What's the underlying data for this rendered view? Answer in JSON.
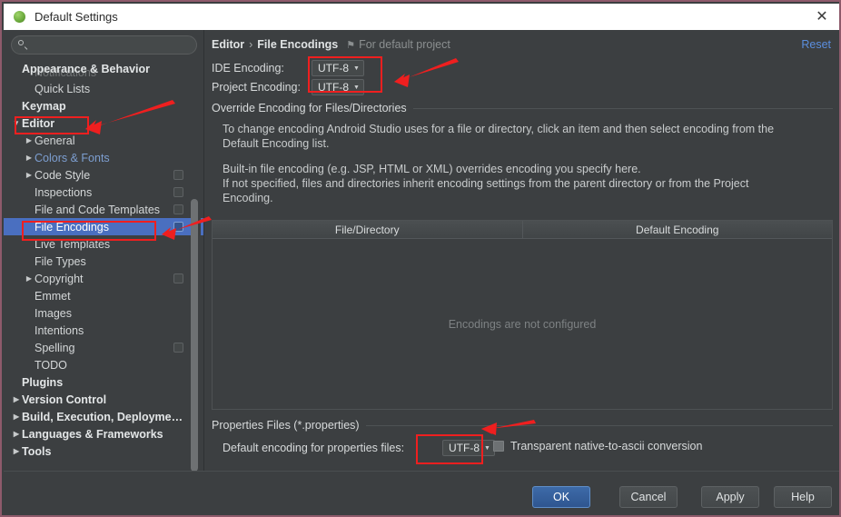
{
  "window": {
    "title": "Default Settings",
    "app_icon": "android-studio-icon",
    "close_icon": "close-icon"
  },
  "search": {
    "placeholder": "",
    "value": "",
    "icon": "search-icon"
  },
  "sidebar": {
    "items": [
      {
        "label": "Appearance & Behavior",
        "indent": 0,
        "bold": true,
        "arrow": "",
        "gutter": false,
        "selected": false,
        "ghost": false,
        "blue": false
      },
      {
        "label": "Notifications",
        "indent": 1,
        "bold": false,
        "arrow": "",
        "gutter": false,
        "selected": false,
        "ghost": true,
        "blue": false
      },
      {
        "label": "Quick Lists",
        "indent": 1,
        "bold": false,
        "arrow": "",
        "gutter": false,
        "selected": false,
        "ghost": false,
        "blue": false
      },
      {
        "label": "Keymap",
        "indent": 0,
        "bold": true,
        "arrow": "",
        "gutter": false,
        "selected": false,
        "ghost": false,
        "blue": false
      },
      {
        "label": "Editor",
        "indent": 0,
        "bold": true,
        "arrow": "▼",
        "gutter": false,
        "selected": false,
        "ghost": false,
        "blue": false
      },
      {
        "label": "General",
        "indent": 1,
        "bold": false,
        "arrow": "▶",
        "gutter": false,
        "selected": false,
        "ghost": false,
        "blue": false
      },
      {
        "label": "Colors & Fonts",
        "indent": 1,
        "bold": false,
        "arrow": "▶",
        "gutter": false,
        "selected": false,
        "ghost": false,
        "blue": true
      },
      {
        "label": "Code Style",
        "indent": 1,
        "bold": false,
        "arrow": "▶",
        "gutter": true,
        "selected": false,
        "ghost": false,
        "blue": false
      },
      {
        "label": "Inspections",
        "indent": 1,
        "bold": false,
        "arrow": "",
        "gutter": true,
        "selected": false,
        "ghost": false,
        "blue": false
      },
      {
        "label": "File and Code Templates",
        "indent": 1,
        "bold": false,
        "arrow": "",
        "gutter": true,
        "selected": false,
        "ghost": false,
        "blue": false
      },
      {
        "label": "File Encodings",
        "indent": 1,
        "bold": false,
        "arrow": "",
        "gutter": true,
        "selected": true,
        "ghost": false,
        "blue": false
      },
      {
        "label": "Live Templates",
        "indent": 1,
        "bold": false,
        "arrow": "",
        "gutter": false,
        "selected": false,
        "ghost": false,
        "blue": false
      },
      {
        "label": "File Types",
        "indent": 1,
        "bold": false,
        "arrow": "",
        "gutter": false,
        "selected": false,
        "ghost": false,
        "blue": false
      },
      {
        "label": "Copyright",
        "indent": 1,
        "bold": false,
        "arrow": "▶",
        "gutter": true,
        "selected": false,
        "ghost": false,
        "blue": false
      },
      {
        "label": "Emmet",
        "indent": 1,
        "bold": false,
        "arrow": "",
        "gutter": false,
        "selected": false,
        "ghost": false,
        "blue": false
      },
      {
        "label": "Images",
        "indent": 1,
        "bold": false,
        "arrow": "",
        "gutter": false,
        "selected": false,
        "ghost": false,
        "blue": false
      },
      {
        "label": "Intentions",
        "indent": 1,
        "bold": false,
        "arrow": "",
        "gutter": false,
        "selected": false,
        "ghost": false,
        "blue": false
      },
      {
        "label": "Spelling",
        "indent": 1,
        "bold": false,
        "arrow": "",
        "gutter": true,
        "selected": false,
        "ghost": false,
        "blue": false
      },
      {
        "label": "TODO",
        "indent": 1,
        "bold": false,
        "arrow": "",
        "gutter": false,
        "selected": false,
        "ghost": false,
        "blue": false
      },
      {
        "label": "Plugins",
        "indent": 0,
        "bold": true,
        "arrow": "",
        "gutter": false,
        "selected": false,
        "ghost": false,
        "blue": false
      },
      {
        "label": "Version Control",
        "indent": 0,
        "bold": true,
        "arrow": "▶",
        "gutter": false,
        "selected": false,
        "ghost": false,
        "blue": false
      },
      {
        "label": "Build, Execution, Deployme…",
        "indent": 0,
        "bold": true,
        "arrow": "▶",
        "gutter": false,
        "selected": false,
        "ghost": false,
        "blue": false
      },
      {
        "label": "Languages & Frameworks",
        "indent": 0,
        "bold": true,
        "arrow": "▶",
        "gutter": false,
        "selected": false,
        "ghost": false,
        "blue": false
      },
      {
        "label": "Tools",
        "indent": 0,
        "bold": true,
        "arrow": "▶",
        "gutter": false,
        "selected": false,
        "ghost": false,
        "blue": false
      }
    ]
  },
  "main": {
    "breadcrumb": {
      "root": "Editor",
      "separator": "›",
      "leaf": "File Encodings",
      "pin_icon": "pin-icon",
      "note": "For default project"
    },
    "reset_label": "Reset",
    "ide_encoding_label": "IDE Encoding:",
    "ide_encoding_value": "UTF-8",
    "project_encoding_label": "Project Encoding:",
    "project_encoding_value": "UTF-8",
    "override_group_title": "Override Encoding for Files/Directories",
    "paragraph_1": "To change encoding Android Studio uses for a file or directory, click an item and then select encoding from the\nDefault Encoding list.",
    "paragraph_2": "Built-in file encoding (e.g. JSP, HTML or XML) overrides encoding you specify here.\nIf not specified, files and directories inherit encoding settings from the parent directory or from the Project\nEncoding.",
    "table": {
      "columns": [
        "File/Directory",
        "Default Encoding"
      ],
      "rows": [],
      "empty_text": "Encodings are not configured"
    },
    "properties_group_title": "Properties Files (*.properties)",
    "properties_encoding_label": "Default encoding for properties files:",
    "properties_encoding_value": "UTF-8",
    "transparent_checkbox_label": "Transparent native-to-ascii conversion",
    "transparent_checkbox_checked": false,
    "caret_glyph": "▼"
  },
  "footer": {
    "ok": "OK",
    "cancel": "Cancel",
    "apply": "Apply",
    "help": "Help"
  },
  "colors": {
    "background": "#3c3f41",
    "selection": "#4a6fc0",
    "link": "#5b8ede",
    "annotation": "#ef1f1f",
    "primary_button": "#3d6aa8",
    "window_border": "#8e5a6b"
  }
}
